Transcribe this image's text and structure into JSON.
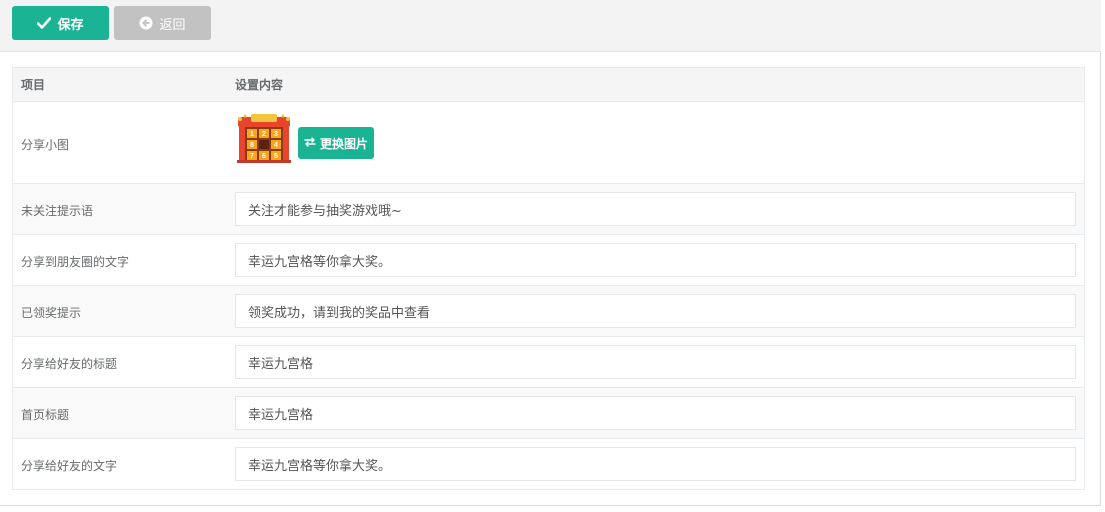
{
  "toolbar": {
    "save_label": "保存",
    "back_label": "返回"
  },
  "colors": {
    "primary": "#1ab394",
    "disabled": "#c2c2c2",
    "header_bg": "#f5f5f6"
  },
  "table": {
    "headers": [
      "项目",
      "设置内容"
    ],
    "share_thumb": {
      "label": "分享小图",
      "image_alt": "lucky nine-grid thumbnail",
      "grid_numbers": [
        "1",
        "2",
        "3",
        "8",
        "4",
        "7",
        "6",
        "5"
      ],
      "change_button": "更换图片"
    },
    "rows": [
      {
        "label": "未关注提示语",
        "value": "关注才能参与抽奖游戏哦~"
      },
      {
        "label": "分享到朋友圈的文字",
        "value": "幸运九宫格等你拿大奖。"
      },
      {
        "label": "已领奖提示",
        "value": "领奖成功，请到我的奖品中查看"
      },
      {
        "label": "分享给好友的标题",
        "value": "幸运九宫格"
      },
      {
        "label": "首页标题",
        "value": "幸运九宫格"
      },
      {
        "label": "分享给好友的文字",
        "value": "幸运九宫格等你拿大奖。"
      }
    ]
  }
}
